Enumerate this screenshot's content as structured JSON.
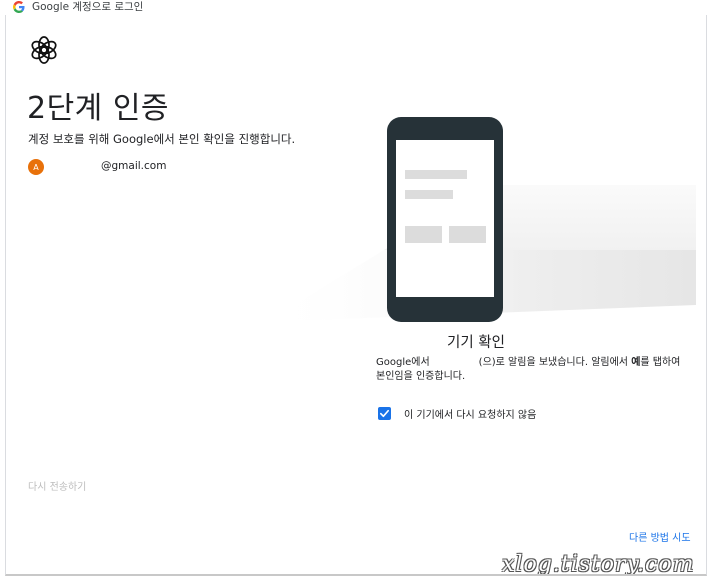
{
  "window": {
    "title": "Google 계정으로 로그인"
  },
  "page": {
    "title": "2단계 인증",
    "subtitle": "계정 보호를 위해 Google에서 본인 확인을 진행합니다.",
    "account": {
      "avatar_initial": "A",
      "email": "@gmail.com"
    },
    "resend_label": "다시 전송하기"
  },
  "verification": {
    "title": "기기 확인",
    "desc_part1": "Google에서",
    "desc_part2": "(으)로 알림을 보냈습니다. 알림에서",
    "desc_bold": "예",
    "desc_part3": "를 탭하여",
    "desc_line2": "본인임을 인증합니다.",
    "dont_ask_label": "이 기기에서 다시 요청하지 않음",
    "dont_ask_checked": true
  },
  "footer": {
    "try_another_label": "다른 방법 시도"
  },
  "watermark": "xlog.tistory.com",
  "colors": {
    "accent": "#1a73e8",
    "avatar": "#e8710a",
    "phone_frame": "#263238",
    "muted_text": "#bdbdbd"
  },
  "icons": {
    "title_logo": "google-g-icon",
    "brand": "openai-logo-icon",
    "checkbox": "check-icon"
  }
}
